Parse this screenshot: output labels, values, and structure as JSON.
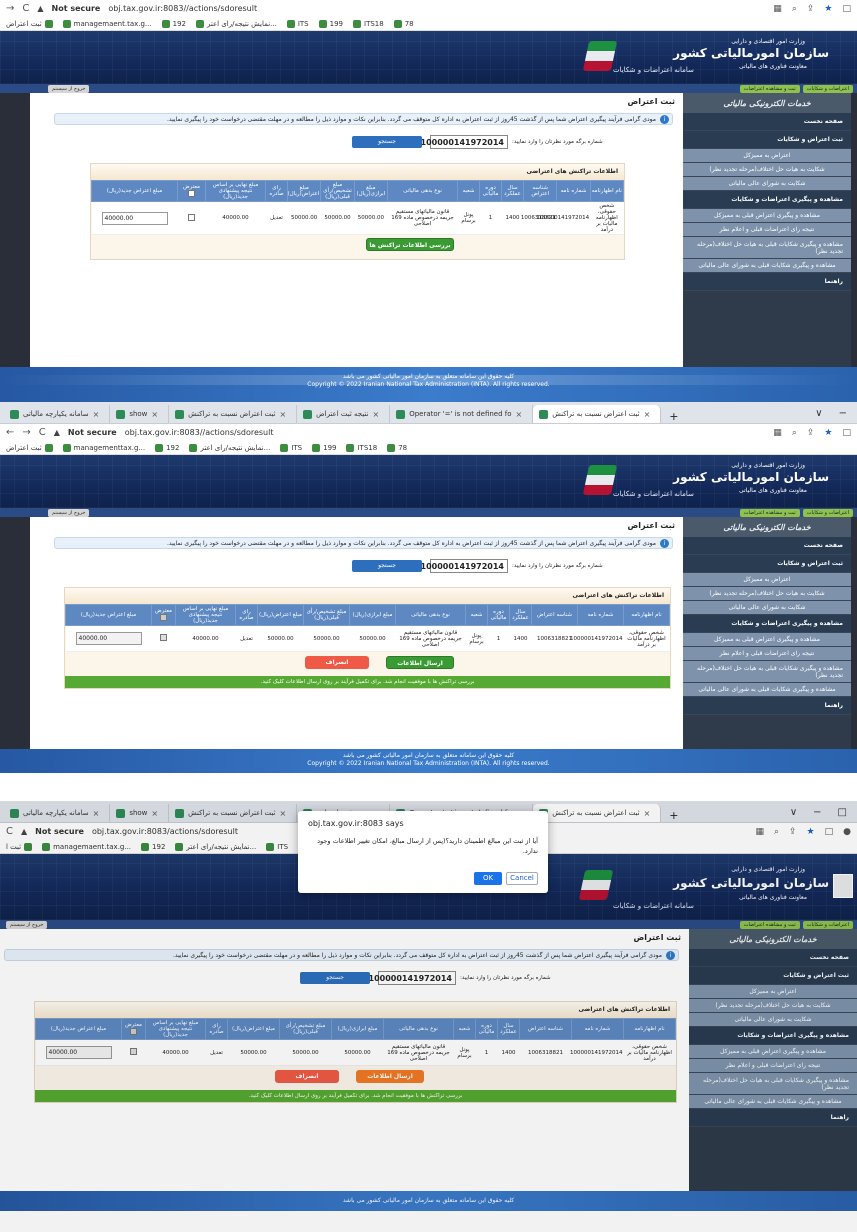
{
  "browser": {
    "tabs": [
      "سامانه یکپارچه مالیاتی",
      "show",
      "نتیجه ثبت اعتراض",
      "ثبت اعتراض نسبت به تراکنش",
      "Operator '=' is not defined fo",
      "ثبت اعتراض نسبت به تراکنش"
    ],
    "tab_close": "×",
    "new_tab": "+",
    "window_controls": [
      "∨",
      "−",
      "□"
    ],
    "not_secure": "Not secure",
    "url": "obj.tax.gov.ir:8083//actions/sdoresult",
    "url_s3": "obj.tax.gov.ir:8083/actions/sdoresult",
    "bookmarks": [
      "ثبت اعتراض",
      "managementtax.g...",
      "192",
      "نمایش نتیجه/رای اعتر...",
      "ITS",
      "199",
      "ITS18",
      "78"
    ],
    "bookmarks_s1": [
      "ثبت اعتراض",
      "managemaent.tax.g...",
      "192",
      "نمایش نتیجه/رای اعتر...",
      "ITS",
      "199",
      "ITS18",
      "78"
    ],
    "bookmarks_s3": [
      "ثبت ا",
      "managemaent.tax.g...",
      "192",
      "نمایش نتیجه/رای اعتر...",
      "ITS",
      "19"
    ]
  },
  "site": {
    "ministry": "وزارت امور اقتصادی و دارایی",
    "org": "سازمان امورمالیاتی کشور",
    "dept": "معاونت فناوری های مالیاتی",
    "system": "سامانه اعتراضات و شکایات",
    "crumbs": [
      "اعتراضات و شکایات",
      "ثبت و مشاهده اعتراضات"
    ],
    "logout": "خروج از سیستم",
    "page_title": "ثبت اعتراض",
    "info_text": "مودی گرامی فرآیند پیگیری اعتراض شما پس از گذشت 45روز از ثبت اعتراض به اداره کل متوقف می گردد. بنابراین نکات و موارد ذیل را مطالعه و در مهلت مقتضی درخواست خود را پیگیری نمایید.",
    "search_label": "شماره برگه مورد نظرتان را وارد نمایید:",
    "search_value": "100000141972014",
    "search_button": "جستجو",
    "panel_title": "اطلاعات تراکنش های اعتراضی",
    "columns": [
      "نام اظهارنامه",
      "شماره نامه",
      "شناسه اعتراض",
      "سال عملکرد",
      "دوره مالیاتی",
      "شعبه",
      "نوع بدهی مالیاتی",
      "مبلغ ابرازی(ریال)",
      "مبلغ تشخیص/رأی قبلی(ریال)",
      "مبلغ اعتراض(ریال)",
      "رای صادره",
      "مبلغ نهایی بر اساس نتیجه پیشنهادی جدید(ریال)",
      "معترض",
      "مبلغ اعتراض جدید(ریال)"
    ],
    "row": {
      "name": "شخص حقوقی، اظهارنامه مالیات بر درآمد",
      "letter_no": "100000141972014",
      "objection_id": "1006318821",
      "year": "1400",
      "period": "1",
      "branch": "پونل برسام",
      "debt_type": "قانون مالیاتهای مستقیم جریمه درخصوص ماده 169 اصلاحی",
      "declared": "50000.00",
      "assessed": "50000.00",
      "objection": "50000.00",
      "verdict": "تعدیل",
      "final": "40000.00",
      "new_amount": "40000.00"
    },
    "btn_review": "بررسی اطلاعات تراکنش ها",
    "btn_send": "ارسال اطلاعات",
    "btn_cancel": "انصراف",
    "success_msg": "بررسی تراکنش ها با موفقیت انجام شد. برای تکمیل فرآیند بر روی ارسال اطلاعات کلیک کنید.",
    "footer1": "کلیه حقوق این سامانه متعلق به سازمان امور مالیاتی کشور می باشد",
    "footer2": "Copyright © 2022 Iranian National Tax Administration (INTA). All rights reserved.",
    "sidebar": {
      "logo": "خدمات الکترونیکی مالیاتی",
      "items": [
        {
          "label": "صفحه نخست",
          "type": "main"
        },
        {
          "label": "ثبت اعتراض و شکایات",
          "type": "main"
        },
        {
          "label": "اعتراض به ممیزکل",
          "type": "sub"
        },
        {
          "label": "شکایت به هیات حل اختلاف(مرحله تجدید نظر)",
          "type": "sub"
        },
        {
          "label": "شکایت به شورای عالی مالیاتی",
          "type": "sub"
        },
        {
          "label": "مشاهده و پیگیری اعتراضات و شکایات",
          "type": "main"
        },
        {
          "label": "مشاهده و پیگیری اعتراض قبلی به ممیزکل",
          "type": "sub"
        },
        {
          "label": "نتیجه رای اعتراضات قبلی و اعلام نظر",
          "type": "sub"
        },
        {
          "label": "مشاهده و پیگیری شکایات قبلی به هیات حل اختلاف(مرحله تجدید نظر)",
          "type": "sub"
        },
        {
          "label": "مشاهده و پیگیری شکایات قبلی به شورای عالی مالیاتی",
          "type": "sub"
        },
        {
          "label": "راهنما",
          "type": "main"
        }
      ]
    }
  },
  "dialog": {
    "title": "obj.tax.gov.ir:8083 says",
    "message": "آیا از ثبت این مبالغ اطمینان دارید؟(پس از ارسال مبالغ، امکان تغییر اطلاعات وجود ندارد.",
    "ok": "OK",
    "cancel": "Cancel"
  }
}
